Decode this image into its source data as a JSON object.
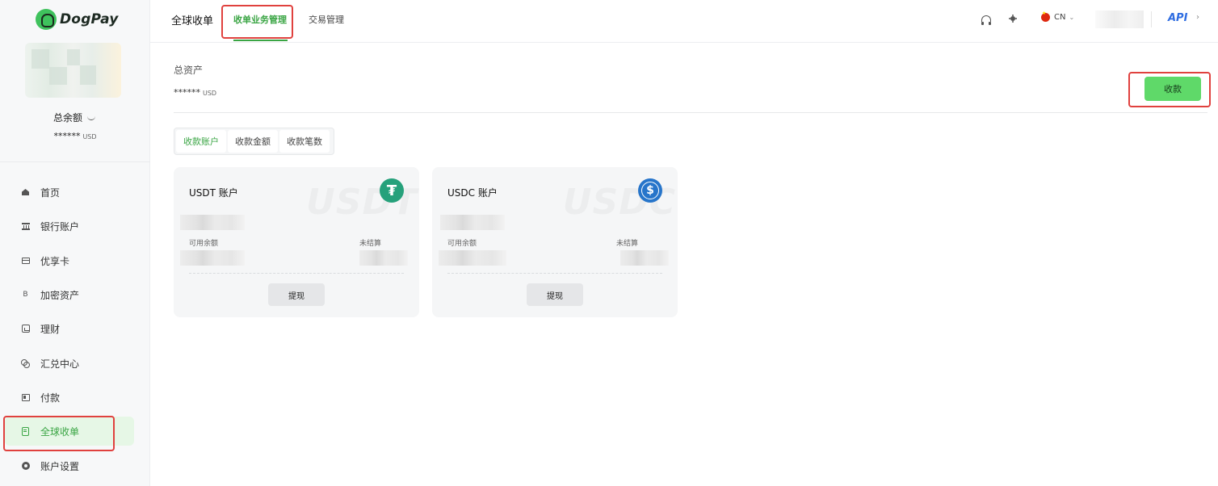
{
  "brand": {
    "name": "DogPay"
  },
  "sidebar": {
    "balance_label": "总余额",
    "balance_value": "******",
    "balance_unit": "USD",
    "items": [
      {
        "label": "首页",
        "icon": "home-icon"
      },
      {
        "label": "银行账户",
        "icon": "bank-icon"
      },
      {
        "label": "优享卡",
        "icon": "card-icon"
      },
      {
        "label": "加密资产",
        "icon": "bitcoin-icon",
        "glyph": "B"
      },
      {
        "label": "理财",
        "icon": "chart-icon"
      },
      {
        "label": "汇兑中心",
        "icon": "exchange-icon"
      },
      {
        "label": "付款",
        "icon": "wallet-icon"
      },
      {
        "label": "全球收单",
        "icon": "document-icon",
        "active": true
      },
      {
        "label": "账户设置",
        "icon": "gear-icon"
      }
    ]
  },
  "header": {
    "title": "全球收单",
    "tabs": [
      {
        "label": "收单业务管理",
        "active": true
      },
      {
        "label": "交易管理",
        "active": false
      }
    ],
    "language": "CN",
    "api_label": "API"
  },
  "main": {
    "assets_label": "总资产",
    "assets_value": "******",
    "assets_unit": "USD",
    "receive_button": "收款",
    "segments": [
      {
        "label": "收款账户",
        "active": true
      },
      {
        "label": "收款金额",
        "active": false
      },
      {
        "label": "收款笔数",
        "active": false
      }
    ],
    "accounts": [
      {
        "title": "USDT 账户",
        "watermark": "USDT",
        "coin_glyph": "₮",
        "available_label": "可用余额",
        "unsettled_label": "未结算",
        "withdraw_label": "提现"
      },
      {
        "title": "USDC 账户",
        "watermark": "USDC",
        "coin_glyph": "$",
        "available_label": "可用余额",
        "unsettled_label": "未结算",
        "withdraw_label": "提现"
      }
    ]
  },
  "colors": {
    "accent": "#3aa544",
    "button_green": "#5fd969",
    "highlight_red": "#e0413e",
    "usdt": "#26a17b",
    "usdc": "#2775ca"
  }
}
